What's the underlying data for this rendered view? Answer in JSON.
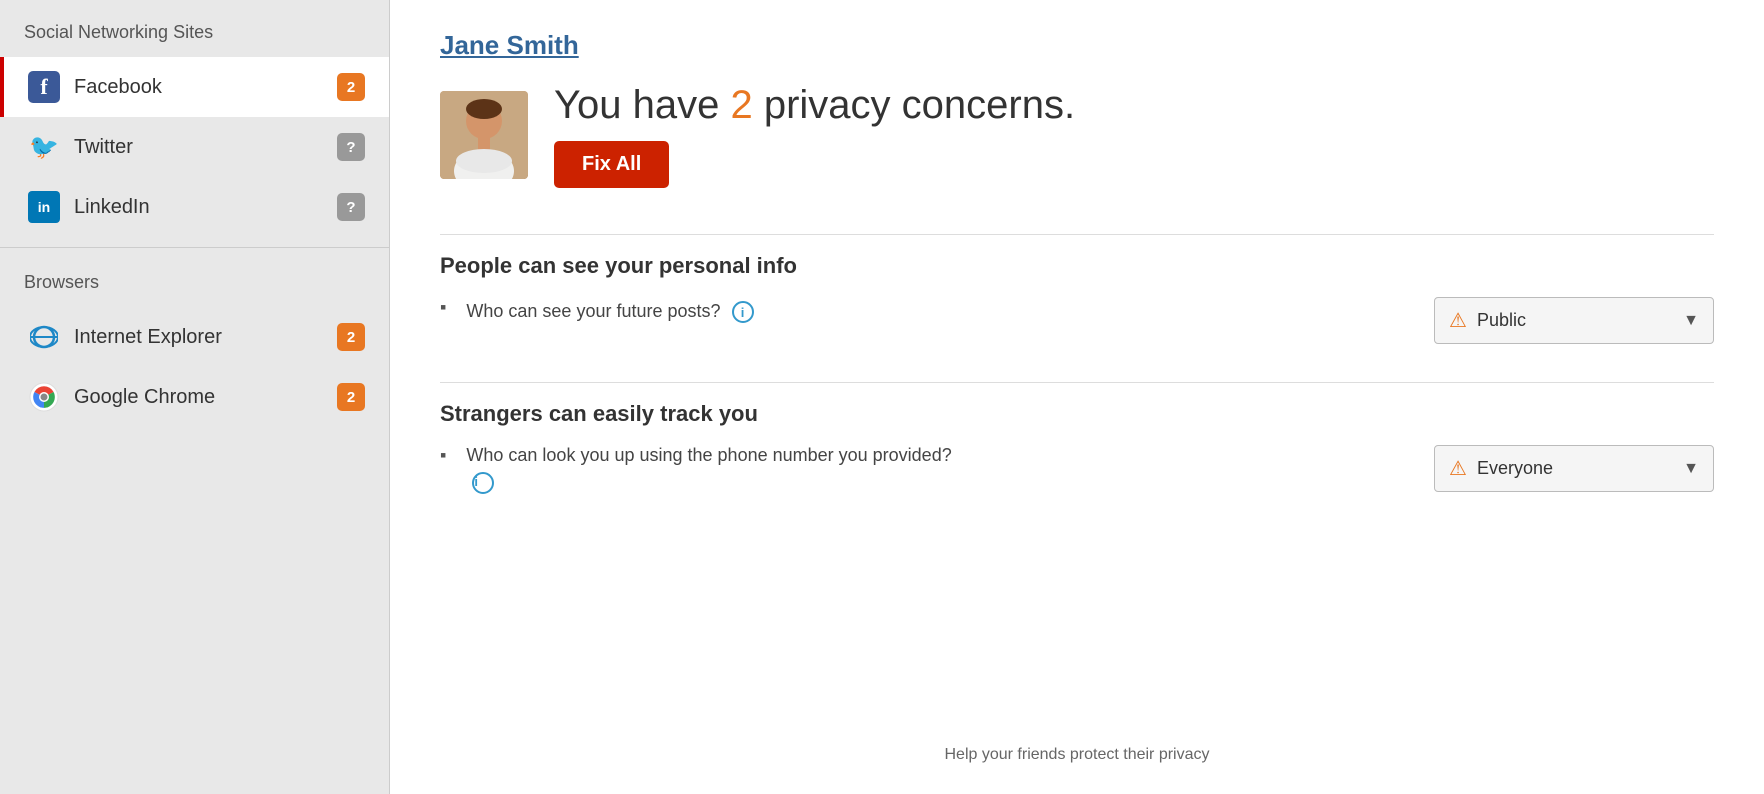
{
  "sidebar": {
    "social_section_title": "Social Networking Sites",
    "browsers_section_title": "Browsers",
    "items": [
      {
        "id": "facebook",
        "label": "Facebook",
        "badge": "2",
        "badge_type": "orange",
        "active": true,
        "icon": "facebook-icon"
      },
      {
        "id": "twitter",
        "label": "Twitter",
        "badge": "?",
        "badge_type": "gray",
        "active": false,
        "icon": "twitter-icon"
      },
      {
        "id": "linkedin",
        "label": "LinkedIn",
        "badge": "?",
        "badge_type": "gray",
        "active": false,
        "icon": "linkedin-icon"
      }
    ],
    "browser_items": [
      {
        "id": "internet-explorer",
        "label": "Internet Explorer",
        "badge": "2",
        "badge_type": "orange",
        "icon": "ie-icon"
      },
      {
        "id": "google-chrome",
        "label": "Google Chrome",
        "badge": "2",
        "badge_type": "orange",
        "icon": "chrome-icon"
      }
    ]
  },
  "main": {
    "user_name": "Jane Smith",
    "privacy_message_prefix": "You have ",
    "privacy_count": "2",
    "privacy_message_suffix": " privacy concerns.",
    "fix_all_label": "Fix All",
    "section1": {
      "heading": "People can see your personal info",
      "items": [
        {
          "text": "Who can see your future posts?",
          "has_info": true,
          "dropdown_value": "Public",
          "dropdown_warning": true
        }
      ]
    },
    "section2": {
      "heading": "Strangers can easily track you",
      "items": [
        {
          "text": "Who can look you up using the phone number you provided?",
          "has_info": true,
          "dropdown_value": "Everyone",
          "dropdown_warning": true
        }
      ]
    },
    "footer_text": "Help your friends protect their privacy"
  }
}
